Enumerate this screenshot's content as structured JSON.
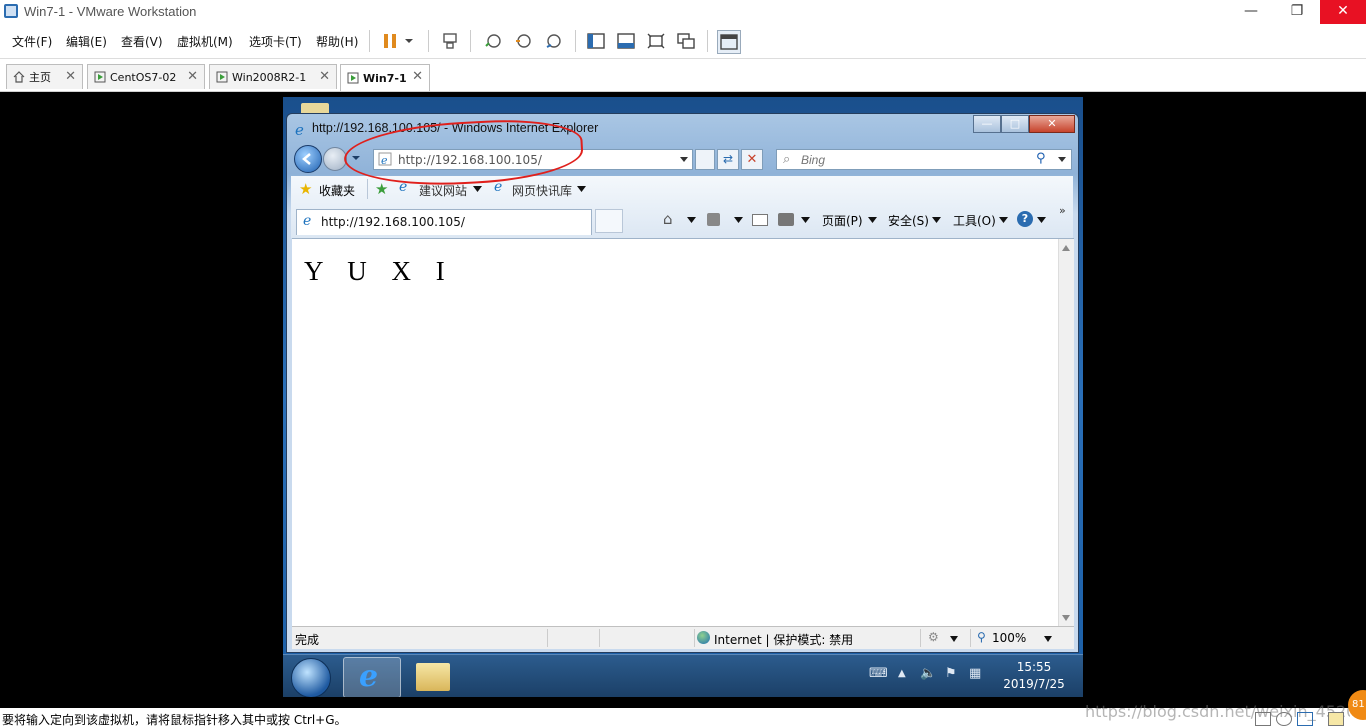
{
  "window": {
    "title": "Win7-1 - VMware Workstation"
  },
  "menu": [
    "文件(F)",
    "编辑(E)",
    "查看(V)",
    "虚拟机(M)",
    "选项卡(T)",
    "帮助(H)"
  ],
  "tabs": [
    {
      "label": "主页"
    },
    {
      "label": "CentOS7-02"
    },
    {
      "label": "Win2008R2-1"
    },
    {
      "label": "Win7-1",
      "active": true
    }
  ],
  "ie": {
    "title": "http://192.168.100.105/ - Windows Internet Explorer",
    "address": "http://192.168.100.105/",
    "search_placeholder": "Bing",
    "favorites_label": "收藏夹",
    "suggested_sites": "建议网站",
    "web_slice": "网页快讯库",
    "tab_label": "http://192.168.100.105/",
    "cmd_page": "页面(P)",
    "cmd_safety": "安全(S)",
    "cmd_tools": "工具(O)",
    "page_content": "Y U X I",
    "status_done": "完成",
    "zone": "Internet | 保护模式: 禁用",
    "zoom": "100%"
  },
  "guest_taskbar": {
    "time": "15:55",
    "date": "2019/7/25"
  },
  "statusline": "要将输入定向到该虚拟机，请将鼠标指针移入其中或按 Ctrl+G。",
  "watermark": "https://blog.csdn.net/weixin_4520022",
  "colors": {
    "annotation": "#e0201c",
    "ie_frame": "#8fb2d8"
  }
}
